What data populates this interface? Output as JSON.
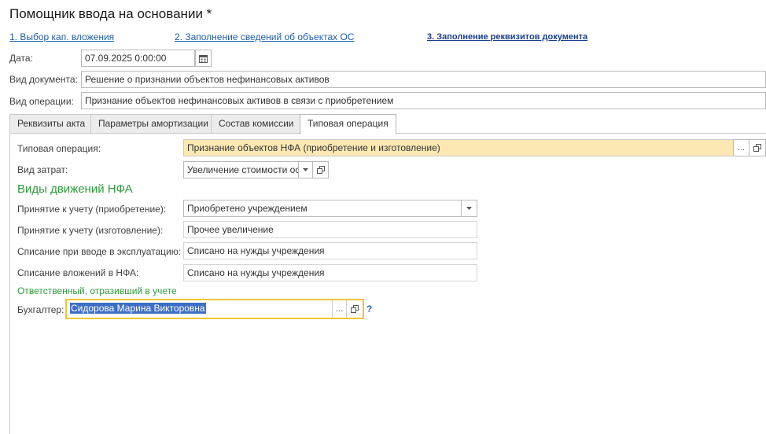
{
  "window": {
    "title": "Помощник ввода на основании *"
  },
  "steps": [
    {
      "label": "1. Выбор кап. вложения"
    },
    {
      "label": "2. Заполнение сведений об объектах ОС"
    },
    {
      "label": "3. Заполнение реквизитов документа"
    }
  ],
  "header": {
    "date_label": "Дата:",
    "date_value": "07.09.2025  0:00:00",
    "doc_type_label": "Вид документа:",
    "doc_type_value": "Решение о признании объектов нефинансовых активов",
    "operation_label": "Вид операции:",
    "operation_value": "Признание объектов нефинансовых активов в связи с приобретением"
  },
  "tabs": [
    {
      "label": "Реквизиты акта"
    },
    {
      "label": "Параметры амортизации"
    },
    {
      "label": "Состав комиссии"
    },
    {
      "label": "Типовая операция"
    }
  ],
  "form": {
    "typical_op_label": "Типовая операция:",
    "typical_op_value": "Признание объектов НФА (приобретение и изготовление)",
    "cost_type_label": "Вид затрат:",
    "cost_type_value": "Увеличение стоимости ос",
    "movements_title": "Виды движений НФА",
    "accept_purchase_label": "Принятие к учету (приобретение):",
    "accept_purchase_value": "Приобретено учреждением",
    "accept_make_label": "Принятие к учету (изготовление):",
    "accept_make_value": "Прочее увеличение",
    "writeoff_commission_label": "Списание при вводе в эксплуатацию:",
    "writeoff_commission_value": "Списано на нужды учреждения",
    "writeoff_invest_label": "Списание вложений в НФА:",
    "writeoff_invest_value": "Списано на нужды учреждения",
    "responsible_title": "Ответственный, отразивший в учете",
    "accountant_label": "Бухгалтер:",
    "accountant_value": "Сидорова Марина Викторовна",
    "help_mark": "?"
  },
  "icons": {
    "ellipsis": "...",
    "calendar": "calendar-icon",
    "open": "open-form-icon",
    "dropdown": "dropdown-arrow-icon"
  },
  "colors": {
    "link": "#1f5fa8",
    "section_green": "#2e9b3a",
    "highlight_field": "#fce8b2",
    "focus_border": "#f0c630",
    "selection": "#3d6fc4"
  }
}
